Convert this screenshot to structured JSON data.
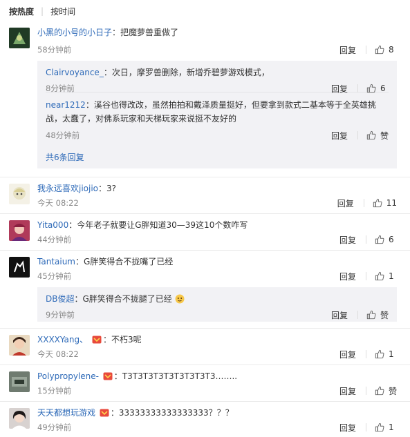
{
  "sort": {
    "hot": "按热度",
    "time": "按时间"
  },
  "comments": [
    {
      "user": "小黑的小号的小日子",
      "text": "把魔萝兽重做了",
      "time": "58分钟前",
      "reply": "回复",
      "likes": "8",
      "replies": [
        {
          "user": "Clairvoyance_",
          "text": "次日，摩罗兽删除，新增乔碧萝游戏模式，",
          "time": "8分钟前",
          "reply": "回复",
          "likes": "6"
        },
        {
          "user": "near1212",
          "text": "溪谷也得改改，虽然拍拍和戴泽质量挺好，但要拿到款式二基本等于全英雄挑战，太蠢了，对佛系玩家和天梯玩家来说挺不友好的",
          "time": "48分钟前",
          "reply": "回复",
          "likes": "赞"
        }
      ],
      "more": "共6条回复"
    },
    {
      "user": "我永远喜欢jiojio",
      "text": "3?",
      "time": "今天 08:22",
      "reply": "回复",
      "likes": "11"
    },
    {
      "user": "Yita000",
      "text": "今年老子就要让G胖知道30—39这10个数咋写",
      "time": "44分钟前",
      "reply": "回复",
      "likes": "6"
    },
    {
      "user": "Tantaium",
      "text": "G胖笑得合不拢嘴了已经",
      "time": "45分钟前",
      "reply": "回复",
      "likes": "1",
      "replies": [
        {
          "user": "DB俊超",
          "text": "G胖笑得合不拢腿了已经",
          "time": "9分钟前",
          "reply": "回复",
          "likes": "赞"
        }
      ]
    },
    {
      "user": "XXXXYang、",
      "text": "不朽3呢",
      "time": "今天 08:22",
      "reply": "回复",
      "likes": "1"
    },
    {
      "user": "Polypropylene-",
      "text": "T3T3T3T3T3T3T3T3T3……..",
      "time": "15分钟前",
      "reply": "回复",
      "likes": "赞"
    },
    {
      "user": "天天都想玩游戏",
      "text": "33333333333333333？？？",
      "time": "49分钟前",
      "reply": "回复",
      "likes": "1"
    }
  ],
  "colors": {
    "username": "#2e6ab8",
    "reply_bg": "#f2f2f5",
    "meta": "#888888"
  }
}
